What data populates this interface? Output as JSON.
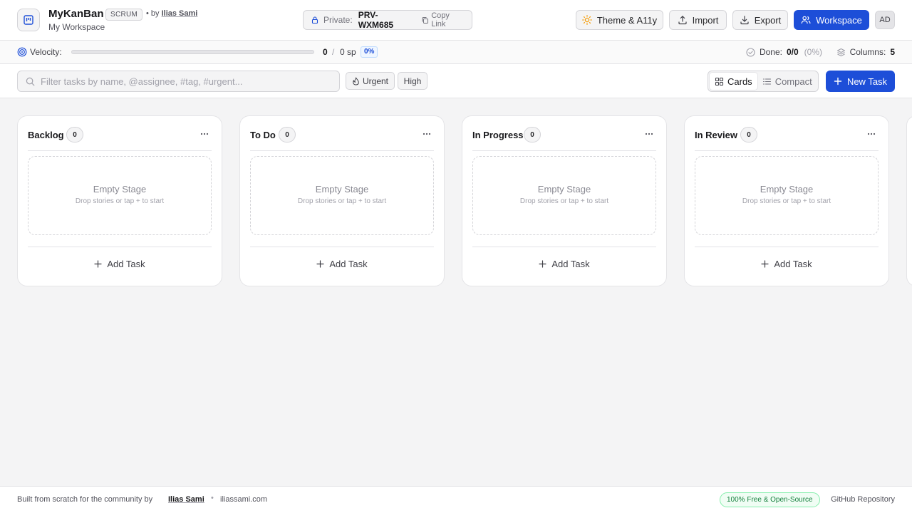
{
  "header": {
    "app_name": "MyKanBan",
    "mode_badge": "SCRUM",
    "by_prefix": "• by",
    "author": "Ilias Sami",
    "workspace_name": "My Workspace",
    "private_label": "Private:",
    "private_code": "PRV-WXM685",
    "copy_link_label": "Copy Link",
    "theme_label": "Theme & A11y",
    "import_label": "Import",
    "export_label": "Export",
    "workspace_label": "Workspace",
    "avatar_initials": "AD"
  },
  "stats": {
    "velocity_label": "Velocity:",
    "velocity_done": "0",
    "velocity_sep": "/",
    "velocity_total": "0 sp",
    "velocity_percent": "0%",
    "velocity_progress": 0,
    "done_label": "Done:",
    "done_value": "0/0",
    "done_percent": "(0%)",
    "columns_label": "Columns:",
    "columns_value": "5"
  },
  "toolbar": {
    "search_placeholder": "Filter tasks by name, @assignee, #tag, #urgent...",
    "search_value": "",
    "filter_urgent": "Urgent",
    "filter_high": "High",
    "view_cards": "Cards",
    "view_compact": "Compact",
    "active_view": "Cards",
    "new_task_label": "New Task"
  },
  "board": {
    "columns": [
      {
        "title": "Backlog",
        "count": "0",
        "empty_title": "Empty Stage",
        "empty_hint": "Drop stories or tap + to start",
        "add_label": "Add Task"
      },
      {
        "title": "To Do",
        "count": "0",
        "empty_title": "Empty Stage",
        "empty_hint": "Drop stories or tap + to start",
        "add_label": "Add Task"
      },
      {
        "title": "In Progress",
        "count": "0",
        "empty_title": "Empty Stage",
        "empty_hint": "Drop stories or tap + to start",
        "add_label": "Add Task"
      },
      {
        "title": "In Review",
        "count": "0",
        "empty_title": "Empty Stage",
        "empty_hint": "Drop stories or tap + to start",
        "add_label": "Add Task"
      }
    ]
  },
  "footer": {
    "built_text": "Built from scratch for the community by",
    "author": "Ilias Sami",
    "dot": "•",
    "site": "iliassami.com",
    "badge": "100% Free & Open-Source",
    "github": "GitHub Repository"
  },
  "colors": {
    "accent": "#1d4ed8",
    "page_bg": "#f4f4f5",
    "success_badge": "#15803d"
  },
  "icons": {
    "logo": "kanban-board-icon",
    "lock": "lock-icon",
    "copy": "copy-icon",
    "theme": "sun-icon",
    "import": "upload-icon",
    "export": "download-icon",
    "workspace": "users-icon",
    "velocity": "target-icon",
    "done": "check-circle-icon",
    "columns": "layers-icon",
    "search": "search-icon",
    "urgent": "flame-icon",
    "cards_view": "grid-icon",
    "compact_view": "list-icon",
    "add": "plus-icon",
    "column_menu": "more-horizontal-icon"
  }
}
